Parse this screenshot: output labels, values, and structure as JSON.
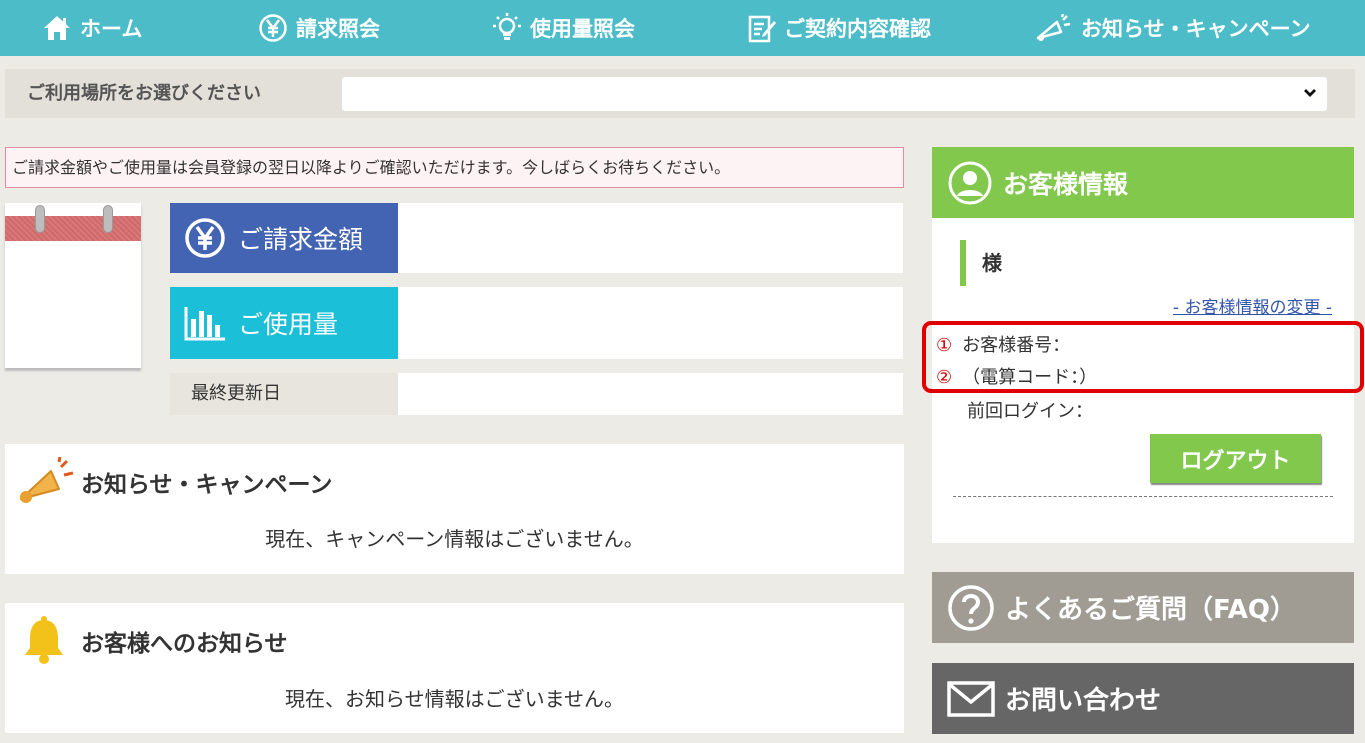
{
  "nav": {
    "home": "ホーム",
    "billing": "請求照会",
    "usage": "使用量照会",
    "contract": "ご契約内容確認",
    "news": "お知らせ・キャンペーン"
  },
  "place": {
    "label": "ご利用場所をお選びください",
    "selected": ""
  },
  "notice": "ご請求金額やご使用量は会員登録の翌日以降よりご確認いただけます。今しばらくお待ちください。",
  "summary": {
    "billing_label": "ご請求金額",
    "billing_value": "",
    "usage_label": "ご使用量",
    "usage_value": "",
    "updated_label": "最終更新日",
    "updated_value": ""
  },
  "campaign": {
    "title": "お知らせ・キャンペーン",
    "message": "現在、キャンペーン情報はございません。"
  },
  "info": {
    "title": "お客様へのお知らせ",
    "message": "現在、お知らせ情報はございません。"
  },
  "customer": {
    "title": "お客様情報",
    "name_suffix": "様",
    "edit_link": "- お客様情報の変更 -",
    "mark1": "①",
    "mark2": "②",
    "number_label": "お客様番号：",
    "code_label": "（電算コード：）",
    "last_login_label": "前回ログイン：",
    "logout": "ログアウト"
  },
  "faq": "よくあるご質問（FAQ）",
  "contact": "お問い合わせ",
  "colors": {
    "nav": "#4bbcc8",
    "green": "#82c84c",
    "billing": "#4363b3",
    "usage": "#1bbfd8",
    "faq": "#a09c94",
    "contact": "#666666",
    "highlight": "#e00000"
  }
}
